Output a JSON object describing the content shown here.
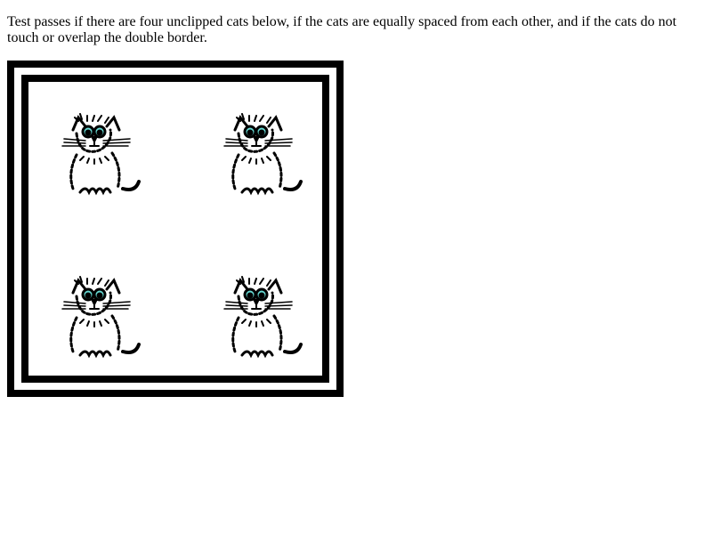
{
  "instructions": {
    "text": "Test passes if there are four unclipped cats below, if the cats are equally spaced from each other, and if the cats do not touch or overlap the double border."
  },
  "cats": [
    {
      "icon": "cat-icon"
    },
    {
      "icon": "cat-icon"
    },
    {
      "icon": "cat-icon"
    },
    {
      "icon": "cat-icon"
    }
  ],
  "colors": {
    "border": "#000000",
    "eye": "#66d9d2",
    "background": "#ffffff"
  }
}
